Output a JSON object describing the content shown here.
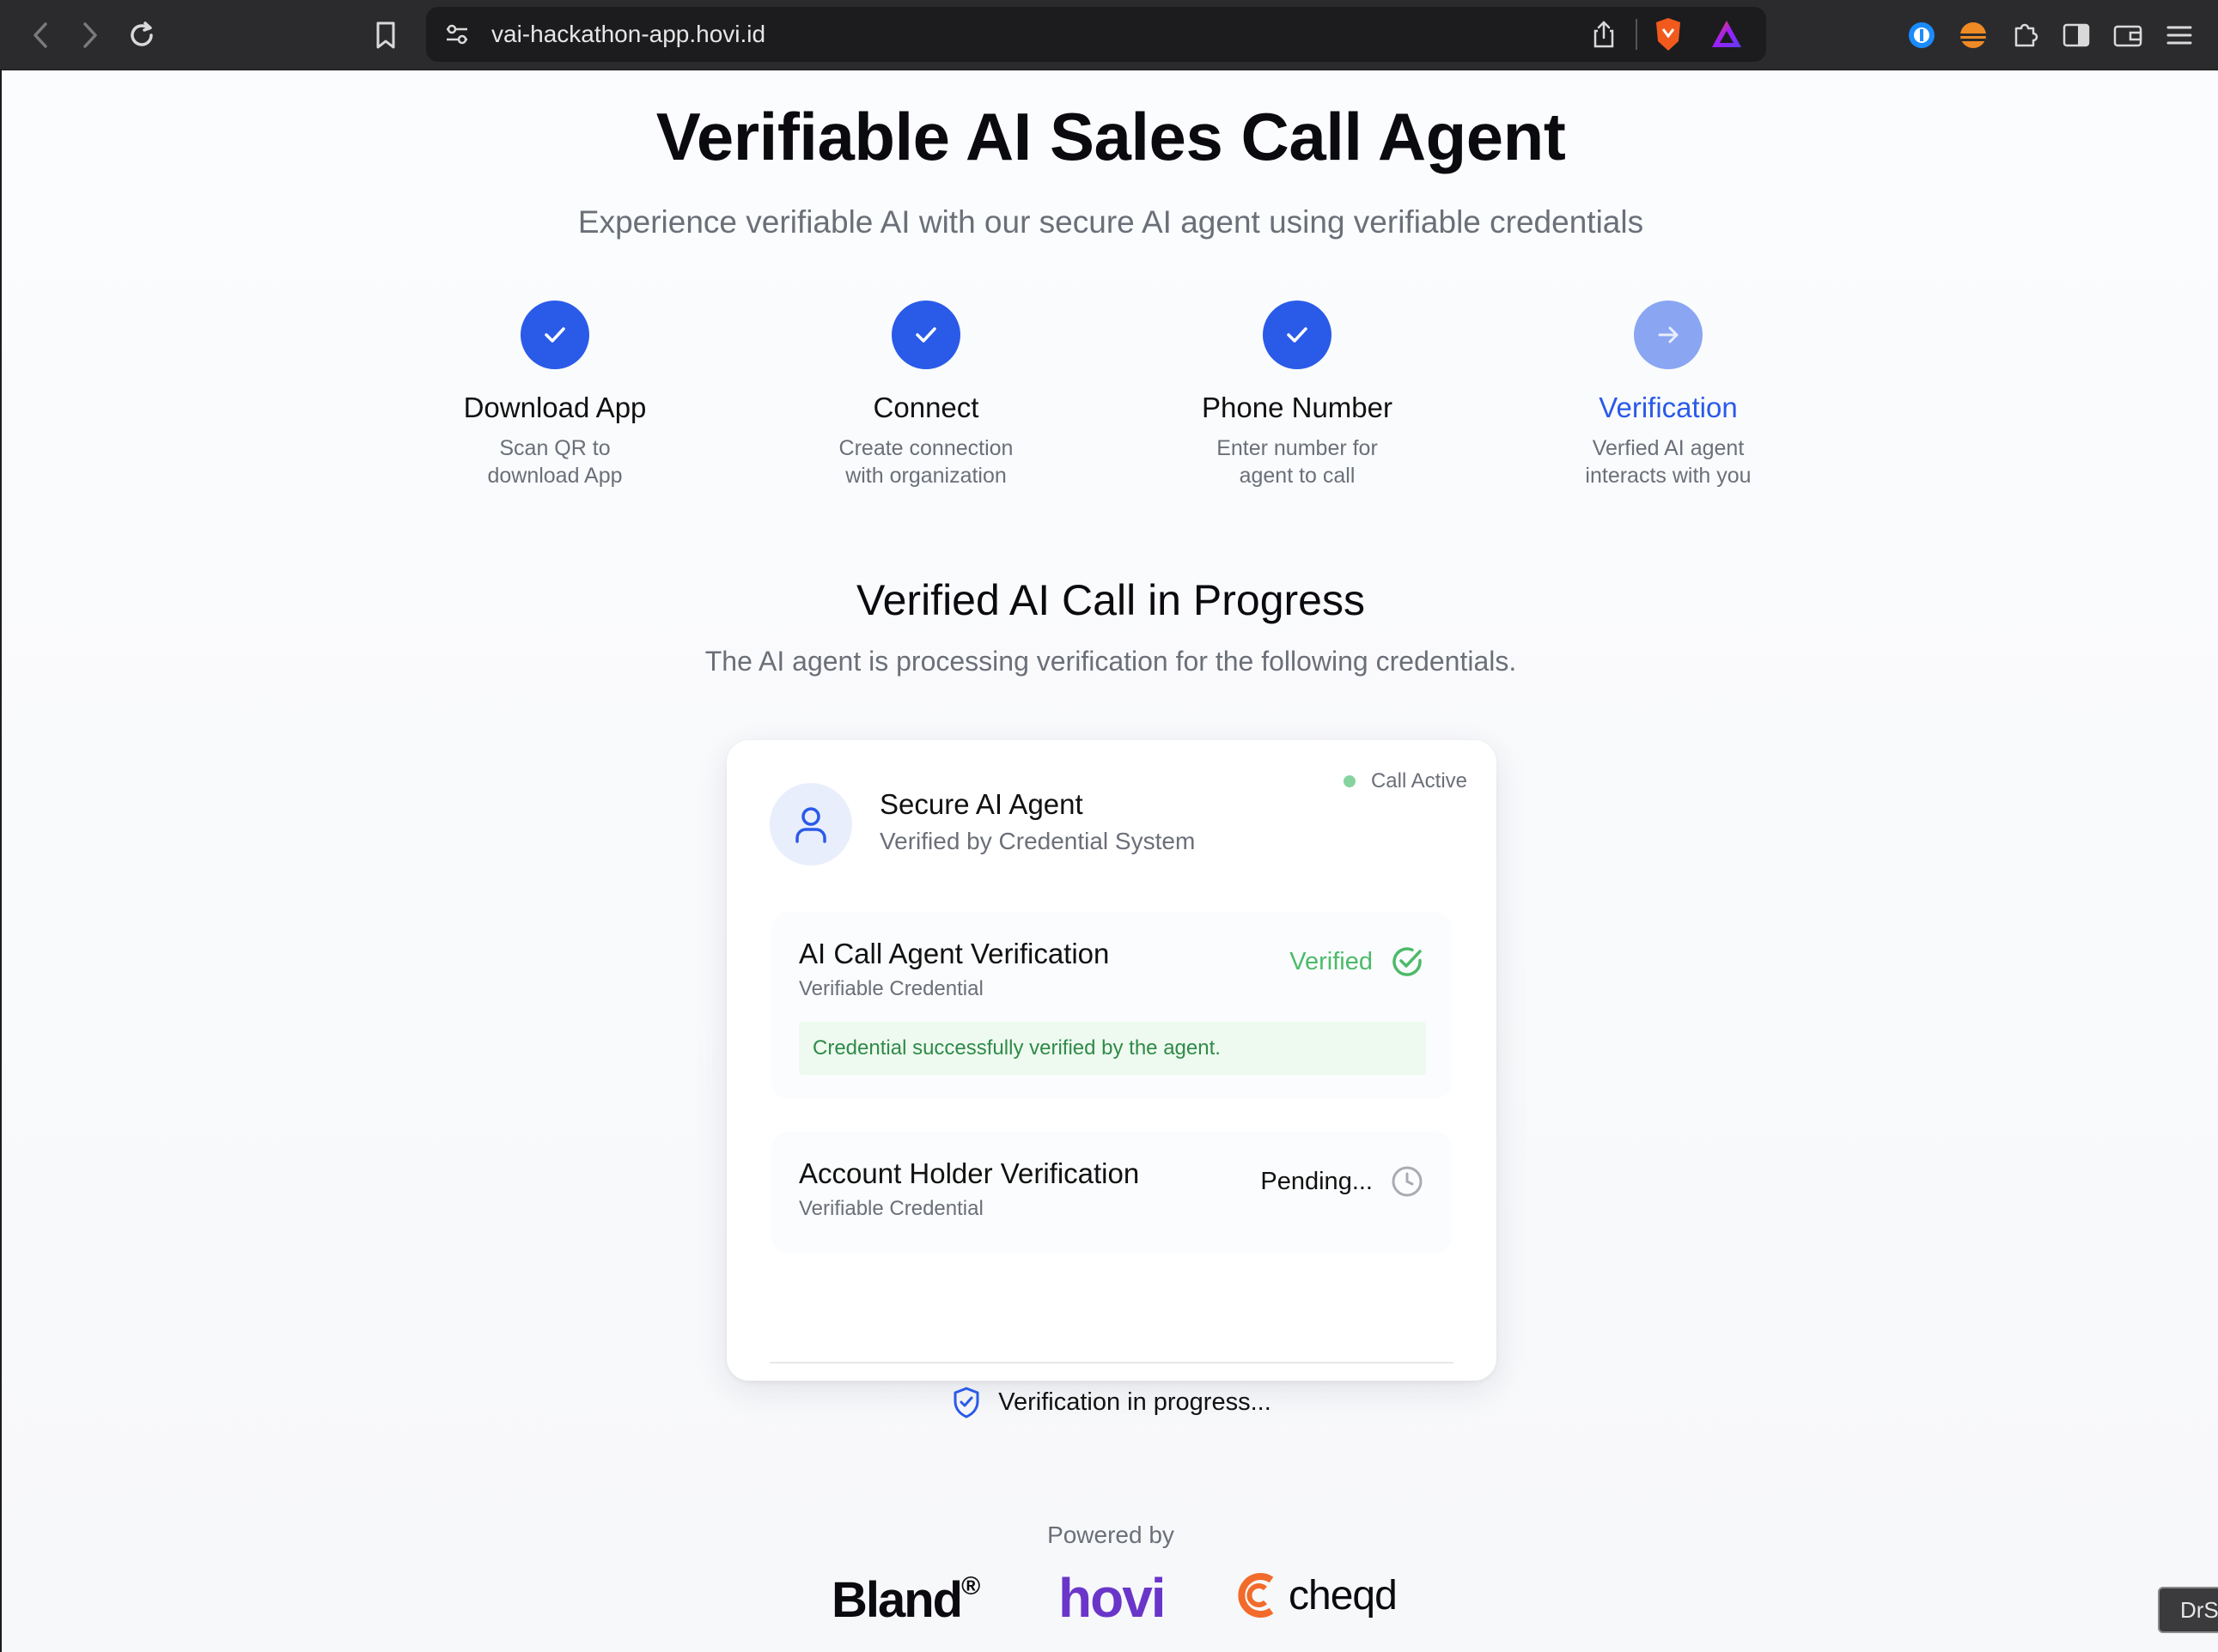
{
  "browser": {
    "url": "vai-hackathon-app.hovi.id"
  },
  "page": {
    "title": "Verifiable AI Sales Call Agent",
    "subtitle": "Experience verifiable AI with our secure AI agent using verifiable credentials"
  },
  "steps": [
    {
      "title": "Download App",
      "desc_line1": "Scan QR to",
      "desc_line2": "download App",
      "state": "completed"
    },
    {
      "title": "Connect",
      "desc_line1": "Create connection",
      "desc_line2": "with organization",
      "state": "completed"
    },
    {
      "title": "Phone Number",
      "desc_line1": "Enter number for",
      "desc_line2": "agent to call",
      "state": "completed"
    },
    {
      "title": "Verification",
      "desc_line1": "Verfied AI agent",
      "desc_line2": "interacts with you",
      "state": "current"
    }
  ],
  "section": {
    "title": "Verified AI Call in Progress",
    "subtitle": "The AI agent is processing verification for the following credentials."
  },
  "card": {
    "status": "Call Active",
    "agent_name": "Secure AI Agent",
    "agent_sub": "Verified by Credential System",
    "credentials": [
      {
        "name": "AI Call Agent Verification",
        "type": "Verifiable Credential",
        "status": "Verified",
        "note": "Credential successfully verified by the agent."
      },
      {
        "name": "Account Holder Verification",
        "type": "Verifiable Credential",
        "status": "Pending..."
      }
    ],
    "footer": "Verification in progress..."
  },
  "footer": {
    "powered_by": "Powered by",
    "logos": {
      "bland": "Bland",
      "bland_mark": "®",
      "hovi": "hovi",
      "cheqd": "cheqd"
    }
  },
  "corner_badge": "DrS",
  "colors": {
    "accent": "#2a5ae8",
    "accent_light": "#8aa6f2",
    "success": "#4cba6a",
    "hovi_purple": "#6a36c9",
    "cheqd_orange": "#f26b2a"
  },
  "icons": [
    "back-icon",
    "forward-icon",
    "reload-icon",
    "bookmark-icon",
    "site-settings-icon",
    "share-icon",
    "brave-shield-icon",
    "brave-rewards-icon",
    "password-manager-icon",
    "extension-icon",
    "puzzle-icon",
    "sidebar-icon",
    "wallet-icon",
    "menu-icon",
    "check-icon",
    "arrow-right-icon",
    "user-icon",
    "check-circle-icon",
    "clock-icon",
    "shield-check-icon"
  ]
}
